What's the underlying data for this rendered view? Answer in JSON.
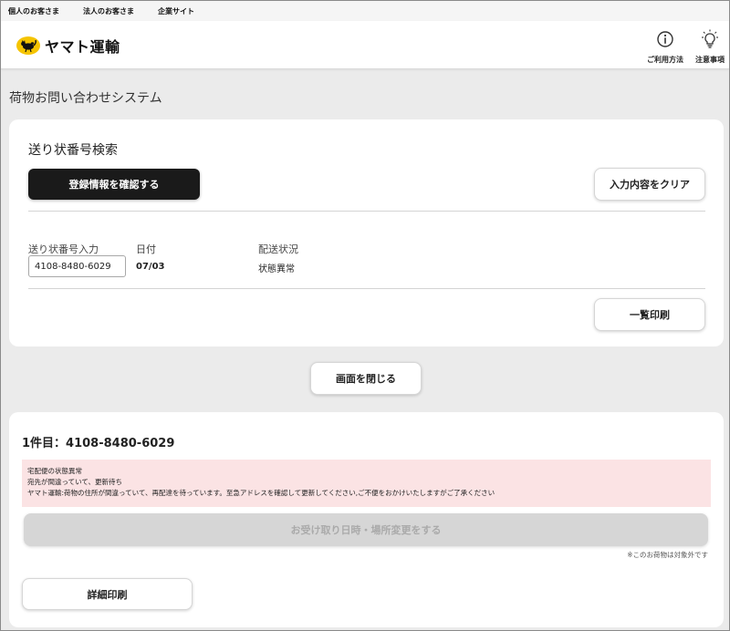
{
  "topbar": {
    "links": [
      "個人のお客さま",
      "法人のお客さま",
      "企業サイト"
    ]
  },
  "header": {
    "logo_text": "ヤマト運輸",
    "usage_label": "ご利用方法",
    "notes_label": "注意事項",
    "usage_icon": "info-icon",
    "notes_icon": "lightbulb-icon",
    "brand_color": "#f5c400"
  },
  "page": {
    "title": "荷物お問い合わせシステム"
  },
  "search": {
    "section_title": "送り状番号検索",
    "confirm_button": "登録情報を確認する",
    "clear_button": "入力内容をクリア",
    "columns": {
      "number": "送り状番号入力",
      "date": "日付",
      "status": "配送状況"
    },
    "row": {
      "number": "4108-8480-6029",
      "date": "07/03",
      "status": "状態異常"
    },
    "print_list_button": "一覧印刷"
  },
  "close_button": "画面を閉じる",
  "result": {
    "title": "1件目：4108-8480-6029",
    "alert_lines": [
      "宅配便の状態異常",
      "宛先が間違っていて、更新待ち",
      "ヤマト運輸:荷物の住所が間違っていて、再配達を待っています。至急アドレスを確認して更新してください,ご不便をおかけいたしますがご了承ください"
    ],
    "alert_color": "#fbe3e4",
    "change_button": "お受け取り日時・場所変更をする",
    "change_note": "※このお荷物は対象外です",
    "detail_print_button": "詳細印刷"
  }
}
